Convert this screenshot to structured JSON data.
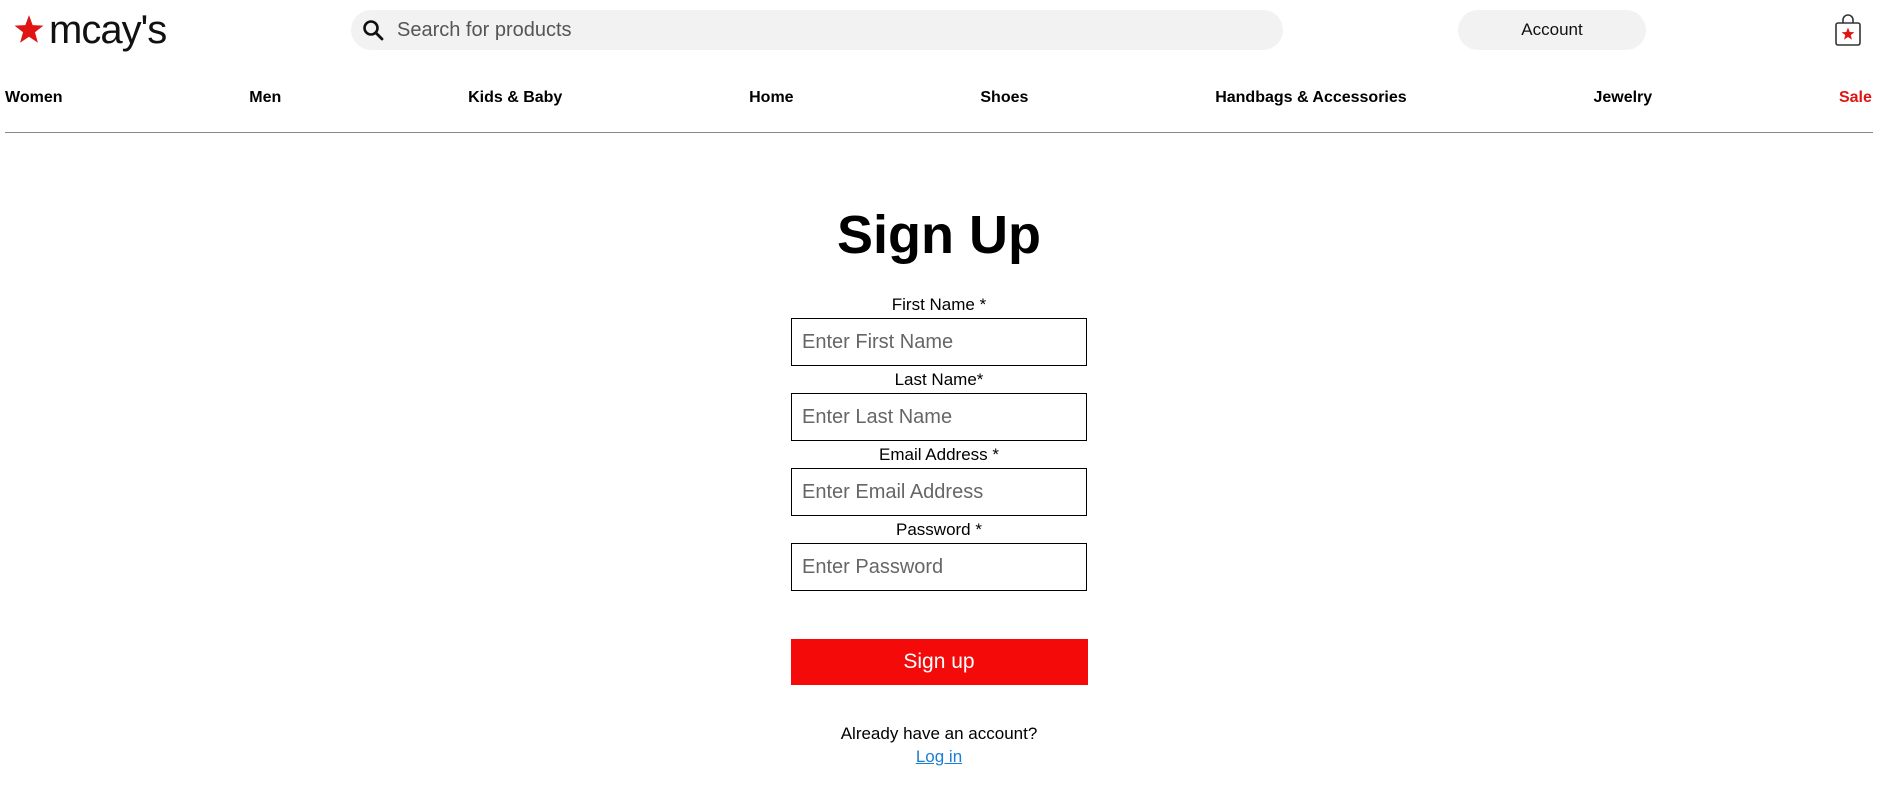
{
  "brand": {
    "name": "mcay's",
    "accent_color": "#e11414"
  },
  "header": {
    "search": {
      "placeholder": "Search for products",
      "value": "",
      "icon": "search-icon"
    },
    "account_label": "Account",
    "bag_icon": "shopping-bag-icon"
  },
  "nav": {
    "items": [
      {
        "label": "Women"
      },
      {
        "label": "Men"
      },
      {
        "label": "Kids & Baby"
      },
      {
        "label": "Home"
      },
      {
        "label": "Shoes"
      },
      {
        "label": "Handbags & Accessories"
      },
      {
        "label": "Jewelry"
      },
      {
        "label": "Sale"
      }
    ]
  },
  "form": {
    "title": "Sign Up",
    "fields": [
      {
        "label": "First Name *",
        "placeholder": "Enter First Name",
        "value": ""
      },
      {
        "label": "Last Name*",
        "placeholder": "Enter Last Name",
        "value": ""
      },
      {
        "label": "Email Address *",
        "placeholder": "Enter Email Address",
        "value": ""
      },
      {
        "label": "Password *",
        "placeholder": "Enter Password",
        "value": ""
      }
    ],
    "submit_label": "Sign up",
    "submit_color": "#f50a0a",
    "already_text": "Already have an account?",
    "login_label": "Log in"
  }
}
